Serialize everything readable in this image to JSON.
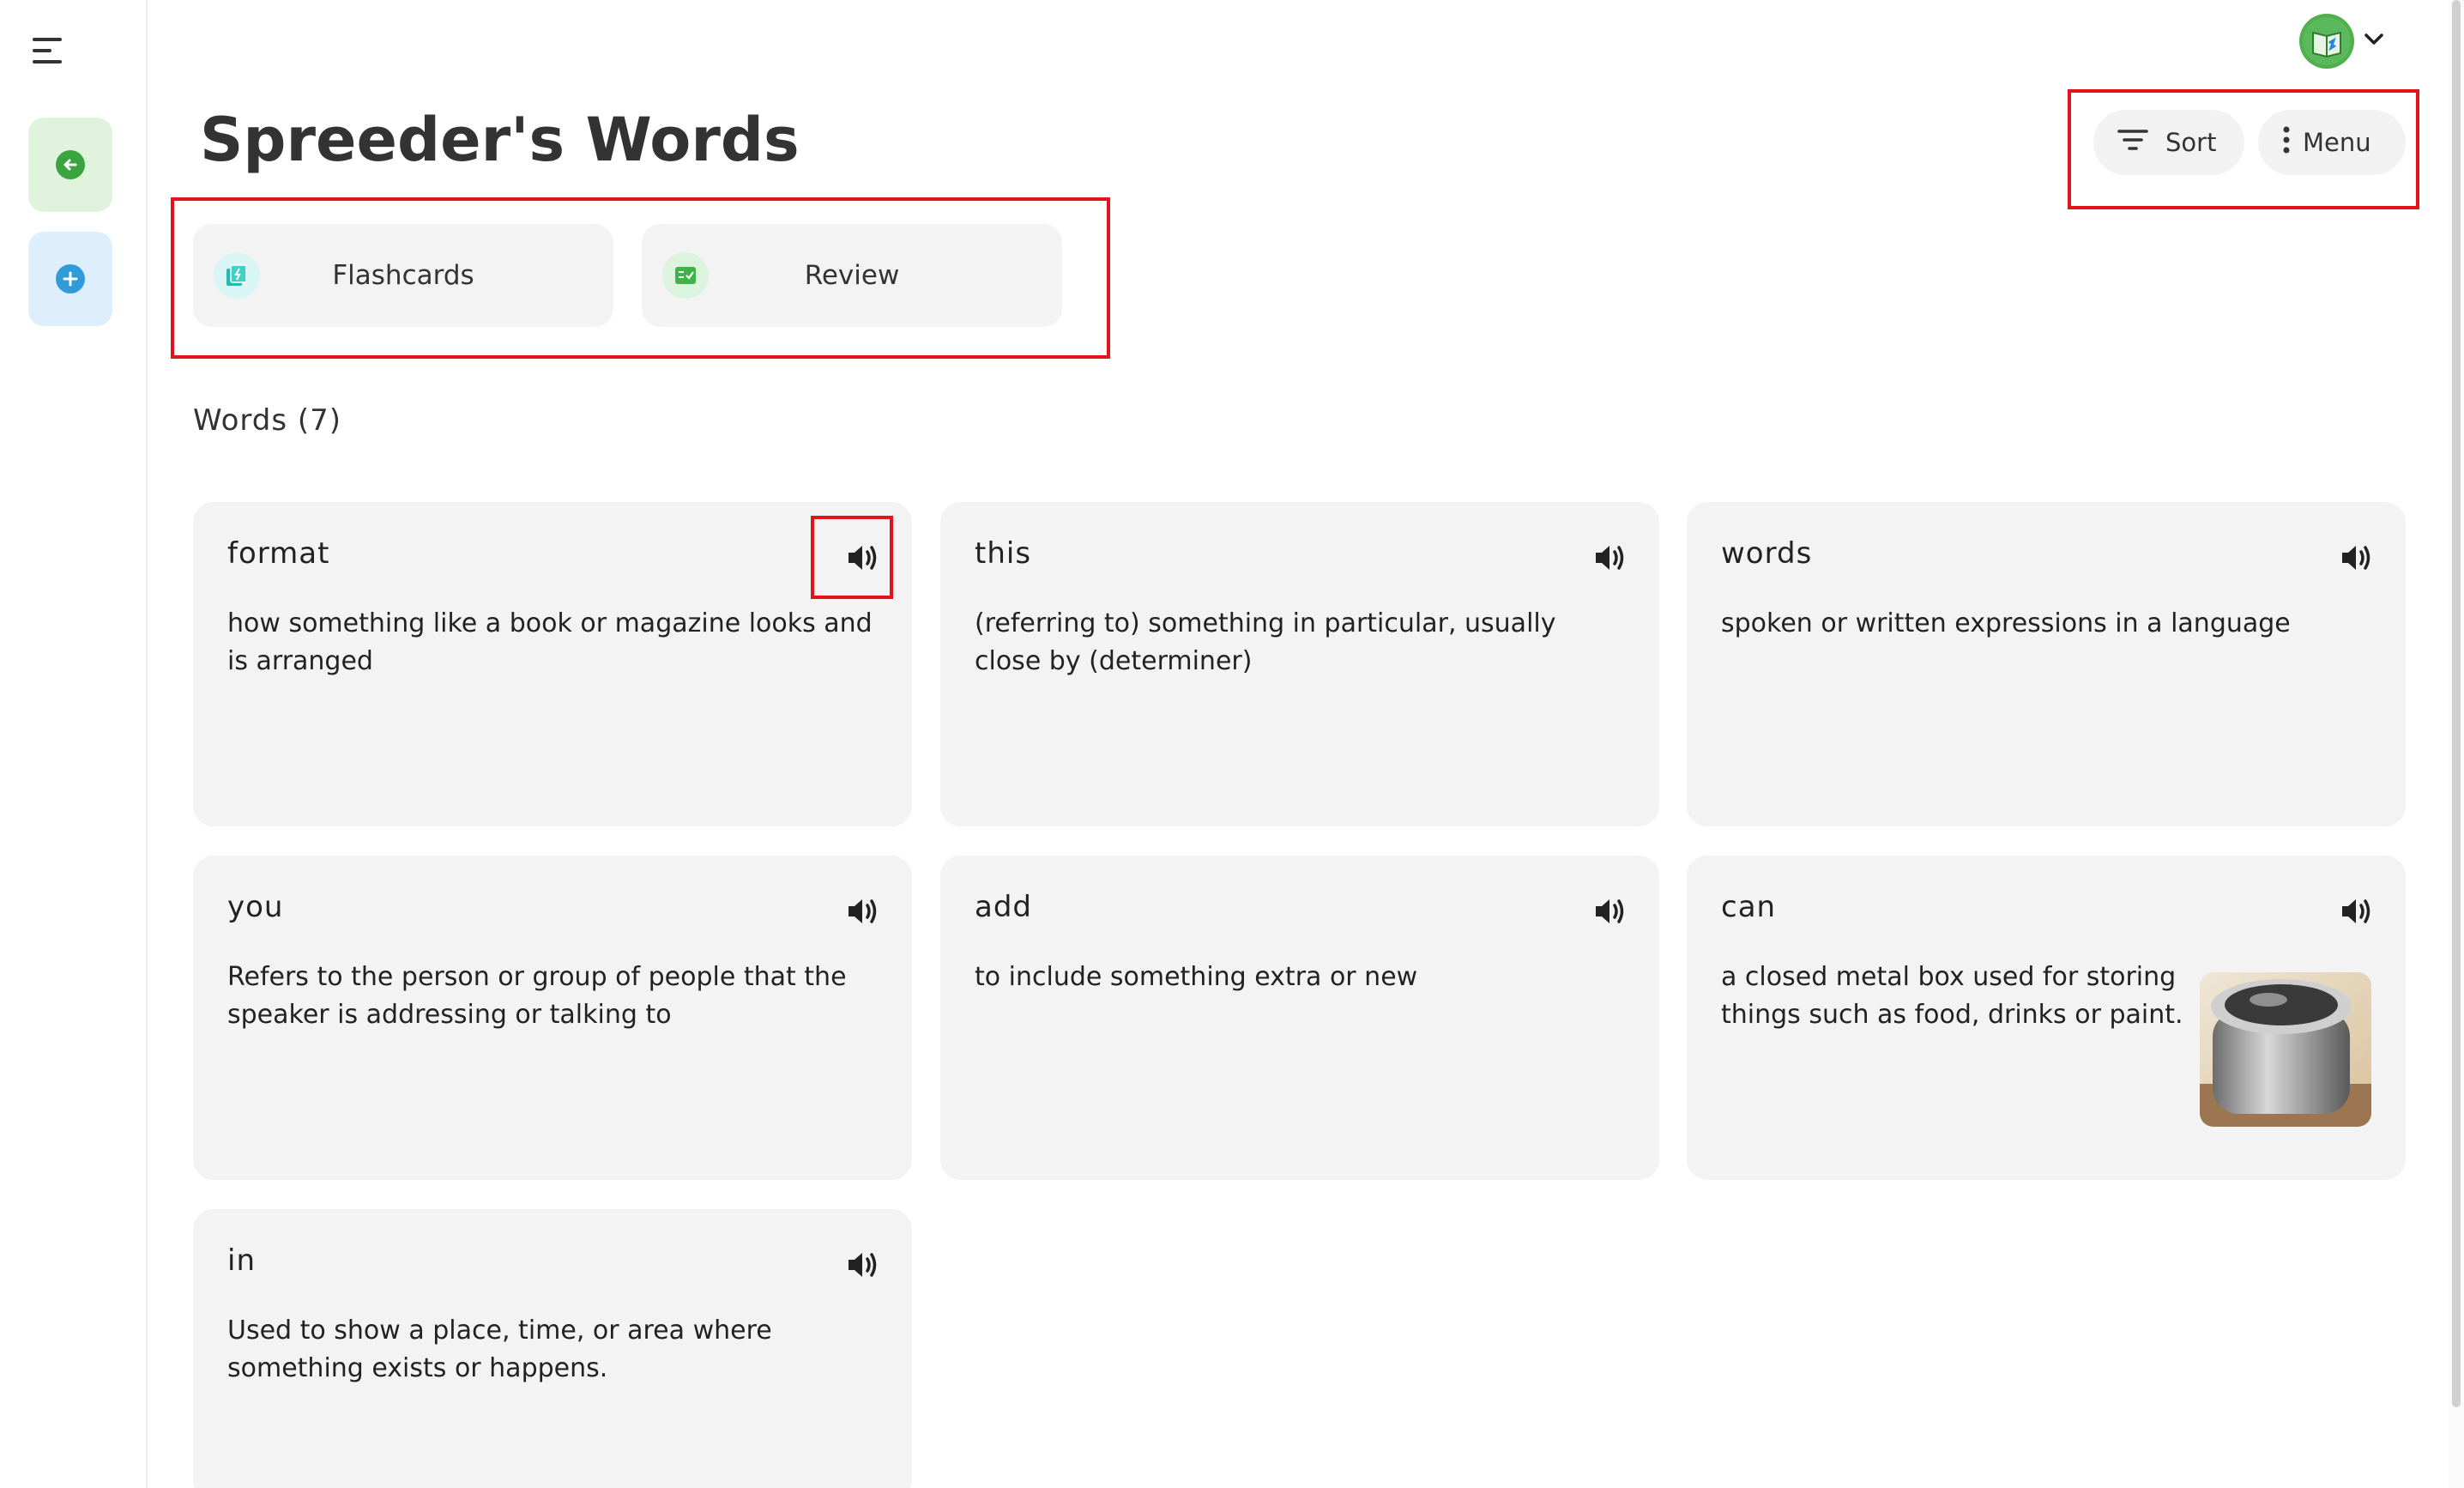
{
  "page": {
    "title": "Spreeder's Words"
  },
  "toolbar": {
    "sort_label": "Sort",
    "menu_label": "Menu"
  },
  "activities": [
    {
      "label": "Flashcards",
      "icon": "flashcards-icon"
    },
    {
      "label": "Review",
      "icon": "review-icon"
    }
  ],
  "words_heading": "Words (7)",
  "words": [
    {
      "word": "format",
      "definition": "how something like a book or magazine looks and is arranged"
    },
    {
      "word": "this",
      "definition": "(referring to) something in particular, usually close by (determiner)"
    },
    {
      "word": "words",
      "definition": "spoken or written expressions in a language"
    },
    {
      "word": "you",
      "definition": "Refers to the person or group of people that the speaker is addressing or talking to"
    },
    {
      "word": "add",
      "definition": "to include something extra or new"
    },
    {
      "word": "can",
      "definition": "a closed metal box used for storing things such as food, drinks or paint."
    },
    {
      "word": "in",
      "definition": "Used to show a place, time, or area where something exists or happens."
    }
  ],
  "colors": {
    "highlight": "#e3131b",
    "card_bg": "#f3f3f3",
    "back_green": "#3aa53f",
    "add_blue": "#2f9bd8"
  }
}
